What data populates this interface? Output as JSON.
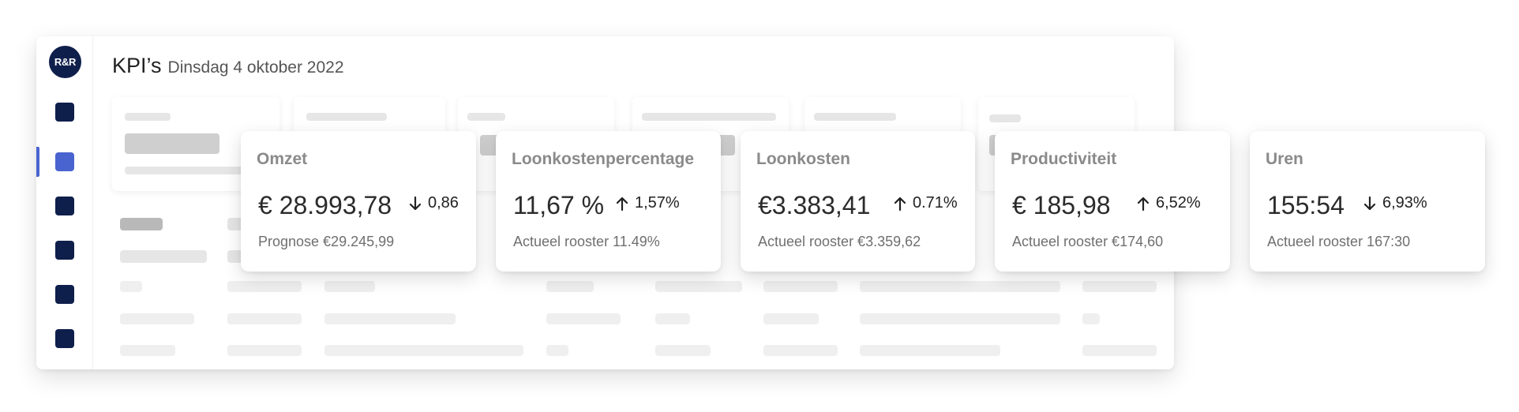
{
  "app": {
    "logo_text": "R&R",
    "title": "KPI’s",
    "date": "Dinsdag 4 oktober 2022",
    "nav_icons": [
      "nav-square-icon",
      "nav-square-icon",
      "nav-square-icon",
      "nav-square-icon",
      "nav-square-icon",
      "nav-square-icon"
    ],
    "active_nav_index": 1
  },
  "colors": {
    "brand_navy": "#0f1f4b",
    "active_blue": "#4a64cf",
    "muted_text": "#8a8a8a"
  },
  "kpis": [
    {
      "title": "Omzet",
      "value": "€ 28.993,78",
      "direction": "down",
      "change": "0,86",
      "sub": "Prognose €29.245,99"
    },
    {
      "title": "Loonkostenpercentage",
      "value": "11,67 %",
      "direction": "up",
      "change": "1,57%",
      "sub": "Actueel rooster 11.49%"
    },
    {
      "title": "Loonkosten",
      "value": "€3.383,41",
      "direction": "up",
      "change": "0.71%",
      "sub": "Actueel rooster €3.359,62"
    },
    {
      "title": "Productiviteit",
      "value": "€ 185,98",
      "direction": "up",
      "change": "6,52%",
      "sub": "Actueel rooster €174,60"
    },
    {
      "title": "Uren",
      "value": "155:54",
      "direction": "down",
      "change": "6,93%",
      "sub": "Actueel rooster 167:30"
    }
  ]
}
